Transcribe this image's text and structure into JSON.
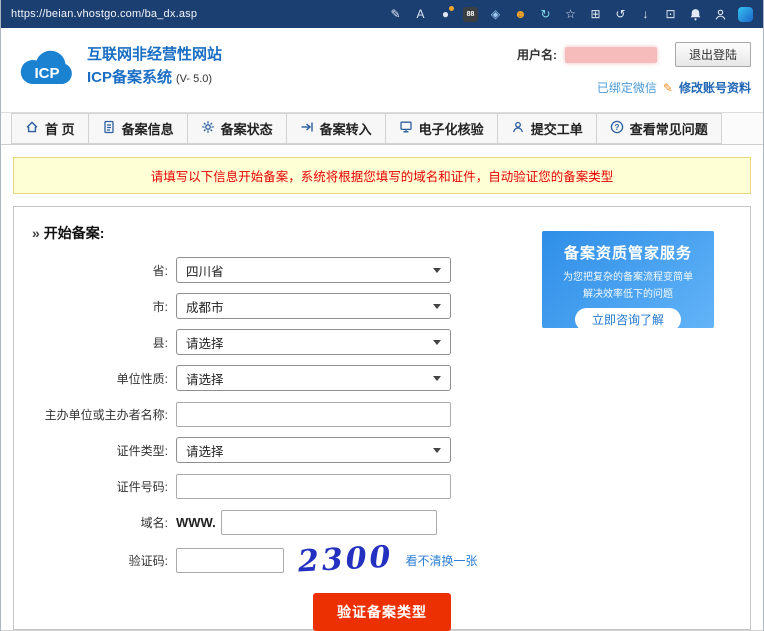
{
  "browser": {
    "url": "https://beian.vhostgo.com/ba_dx.asp",
    "icons": [
      {
        "name": "highlighter-pen-icon",
        "glyph": "✎"
      },
      {
        "name": "read-aloud-icon",
        "glyph": "A"
      },
      {
        "name": "password-extension-icon",
        "glyph": "●"
      },
      {
        "name": "screenshot-extension-icon",
        "glyph": "88"
      },
      {
        "name": "drop-extension-icon",
        "glyph": "◈"
      },
      {
        "name": "emoji-extension-icon",
        "glyph": "☻"
      },
      {
        "name": "refresh-extension-icon",
        "glyph": "↻"
      },
      {
        "name": "favorites-star-icon",
        "glyph": "☆"
      },
      {
        "name": "collections-icon",
        "glyph": "⊞"
      },
      {
        "name": "history-icon",
        "glyph": "↺"
      },
      {
        "name": "downloads-icon",
        "glyph": "↓"
      },
      {
        "name": "apps-icon",
        "glyph": "⊡"
      },
      {
        "name": "notifications-bell-icon"
      },
      {
        "name": "profile-icon"
      },
      {
        "name": "edge-hub-icon"
      }
    ]
  },
  "header": {
    "logo_text": "ICP",
    "title_line1": "互联网非经营性网站",
    "title_line2": "ICP备案系统",
    "version": "(V- 5.0)",
    "username_label": "用户名:",
    "logout_label": "退出登陆",
    "wechat_bound_label": "已绑定微信",
    "edit_icon": "✎",
    "edit_account_label": "修改账号资料"
  },
  "nav": {
    "items": [
      {
        "label": "首 页",
        "icon": "home-icon"
      },
      {
        "label": "备案信息",
        "icon": "document-icon"
      },
      {
        "label": "备案状态",
        "icon": "gear-icon"
      },
      {
        "label": "备案转入",
        "icon": "transfer-arrow-icon"
      },
      {
        "label": "电子化核验",
        "icon": "monitor-icon"
      },
      {
        "label": "提交工单",
        "icon": "user-icon"
      },
      {
        "label": "查看常见问题",
        "icon": "question-icon"
      }
    ]
  },
  "notice": {
    "text": "请填写以下信息开始备案，系统将根据您填写的域名和证件，自动验证您的备案类型"
  },
  "form": {
    "title": "开始备案:",
    "title_arrow": "»",
    "fields": [
      {
        "label": "省:",
        "type": "select",
        "value": "四川省"
      },
      {
        "label": "市:",
        "type": "select",
        "value": "成都市"
      },
      {
        "label": "县:",
        "type": "select",
        "value": "请选择"
      },
      {
        "label": "单位性质:",
        "type": "select",
        "value": "请选择"
      },
      {
        "label": "主办单位或主办者名称:",
        "type": "input",
        "value": ""
      },
      {
        "label": "证件类型:",
        "type": "select",
        "value": "请选择"
      },
      {
        "label": "证件号码:",
        "type": "input",
        "value": ""
      },
      {
        "label": "域名:",
        "type": "domain",
        "prefix": "WWW.",
        "value": ""
      },
      {
        "label": "验证码:",
        "type": "captcha",
        "value": ""
      }
    ],
    "captcha_text": "2300",
    "refresh_label": "看不清换一张",
    "submit_label": "验证备案类型"
  },
  "promo": {
    "title": "备案资质管家服务",
    "line1": "为您把复杂的备案流程变简单",
    "line2": "解决效率低下的问题",
    "button_label": "立即咨询了解",
    "accent_color": "#2e8ee8"
  },
  "colors": {
    "toolbar": "#1c3f72",
    "brand_blue": "#1a6fc4",
    "notice_red": "#e60000",
    "submit_red": "#ec3001"
  }
}
